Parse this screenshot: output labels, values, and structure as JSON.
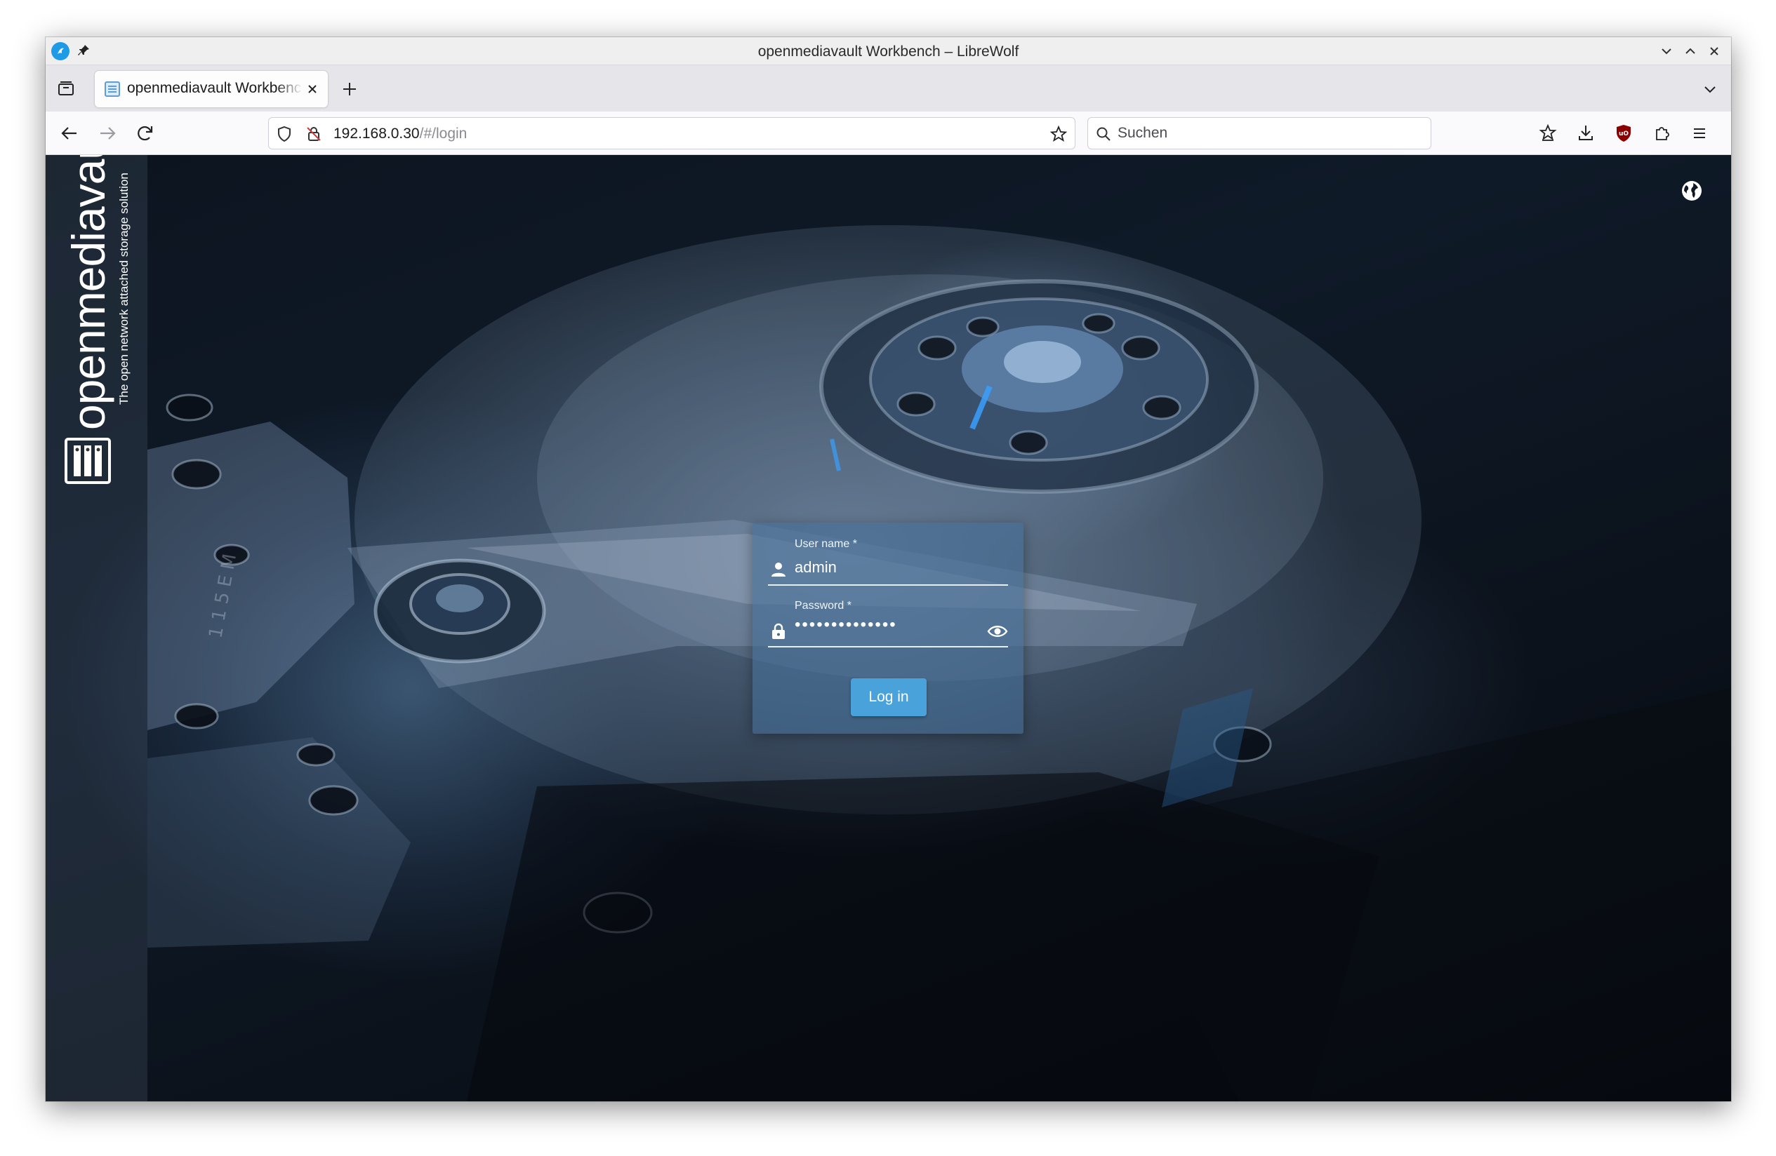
{
  "window": {
    "title": "openmediavault Workbench – LibreWolf"
  },
  "tabs": [
    {
      "label": "openmediavault Workbench"
    }
  ],
  "urlbar": {
    "host": "192.168.0.30",
    "path": "/#/login"
  },
  "search": {
    "placeholder": "Suchen"
  },
  "brand": {
    "name": "openmediavault",
    "tagline": "The open network attached storage solution"
  },
  "login": {
    "username_label": "User name *",
    "username_value": "admin",
    "password_label": "Password *",
    "password_mask": "••••••••••••••",
    "submit_label": "Log in"
  },
  "colors": {
    "accent": "#4aa2db",
    "ublock": "#8b0000"
  }
}
